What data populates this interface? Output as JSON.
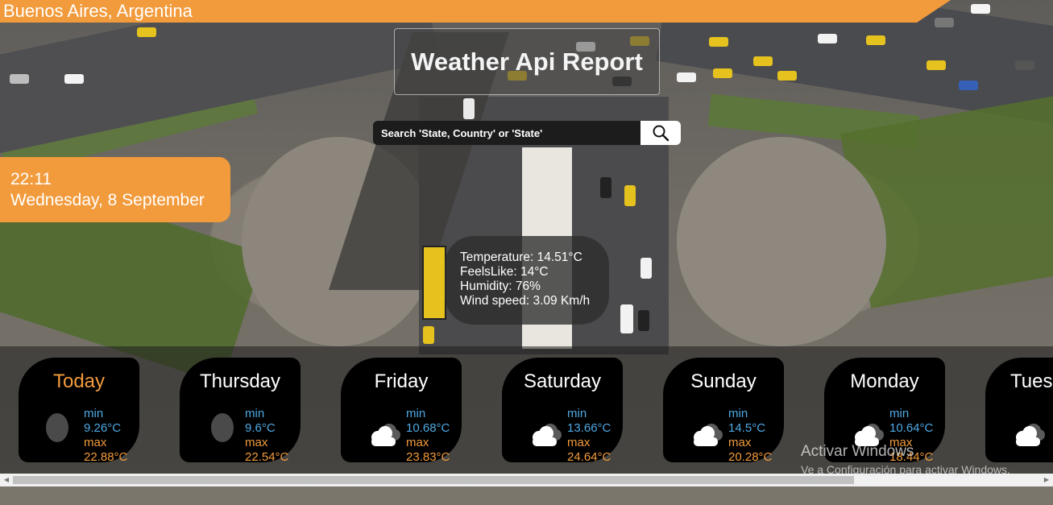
{
  "location": "Buenos Aires, Argentina",
  "title": "Weather Api Report",
  "search": {
    "placeholder": "Search 'State, Country' or 'State'"
  },
  "datetime": {
    "time": "22:11",
    "date": "Wednesday, 8 September"
  },
  "current": {
    "temperature": "Temperature: 14.51°C",
    "feels_like": "FeelsLike: 14°C",
    "humidity": "Humidity: 76%",
    "wind": "Wind speed: 3.09 Km/h"
  },
  "forecast": [
    {
      "day": "Today",
      "min_label": "min",
      "min": "9.26°C",
      "max_label": "max",
      "max": "22.88°C",
      "icon": "moon-icon"
    },
    {
      "day": "Thursday",
      "min_label": "min",
      "min": "9.6°C",
      "max_label": "max",
      "max": "22.54°C",
      "icon": "moon-icon"
    },
    {
      "day": "Friday",
      "min_label": "min",
      "min": "10.68°C",
      "max_label": "max",
      "max": "23.83°C",
      "icon": "cloud-icon"
    },
    {
      "day": "Saturday",
      "min_label": "min",
      "min": "13.66°C",
      "max_label": "max",
      "max": "24.64°C",
      "icon": "cloud-icon"
    },
    {
      "day": "Sunday",
      "min_label": "min",
      "min": "14.5°C",
      "max_label": "max",
      "max": "20.28°C",
      "icon": "cloud-icon"
    },
    {
      "day": "Monday",
      "min_label": "min",
      "min": "10.64°C",
      "max_label": "max",
      "max": "18.44°C",
      "icon": "cloud-icon"
    },
    {
      "day": "Tues",
      "min_label": "",
      "min": "",
      "max_label": "",
      "max": "",
      "icon": "cloud-icon"
    }
  ],
  "watermark": {
    "title": "Activar Windows",
    "subtitle": "Ve a Configuración para activar Windows."
  },
  "colors": {
    "accent": "#f29b3c",
    "min_temp": "#4fa9e3",
    "card_bg": "#000000"
  }
}
